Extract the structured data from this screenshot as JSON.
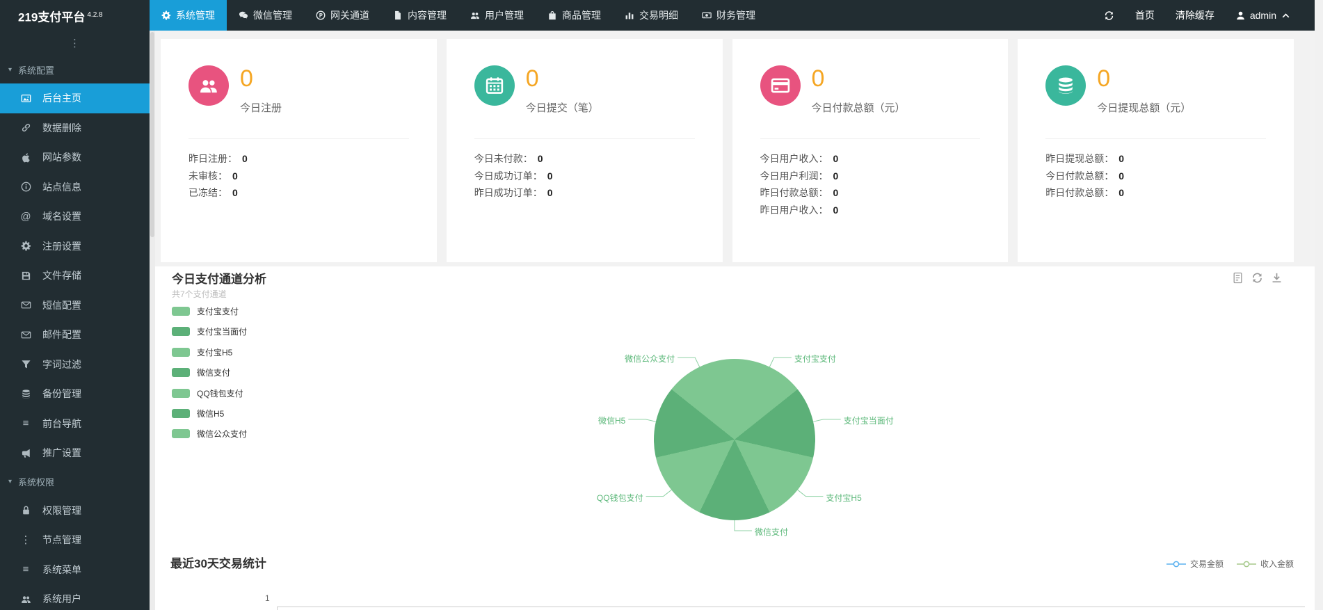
{
  "brand": {
    "title": "219支付平台",
    "version": "4.2.8"
  },
  "topnav": {
    "items": [
      {
        "label": "系统管理",
        "icon": "gear",
        "active": true
      },
      {
        "label": "微信管理",
        "icon": "wechat",
        "active": false
      },
      {
        "label": "网关通道",
        "icon": "p-circle",
        "active": false
      },
      {
        "label": "内容管理",
        "icon": "file",
        "active": false
      },
      {
        "label": "用户管理",
        "icon": "users",
        "active": false
      },
      {
        "label": "商品管理",
        "icon": "bag",
        "active": false
      },
      {
        "label": "交易明细",
        "icon": "bar-chart",
        "active": false
      },
      {
        "label": "财务管理",
        "icon": "money",
        "active": false
      }
    ],
    "right": {
      "home": "首页",
      "clear_cache": "清除缓存",
      "user": "admin"
    }
  },
  "sidebar": {
    "groups": [
      {
        "label": "系统配置",
        "items": [
          {
            "label": "后台主页",
            "icon": "image",
            "active": true
          },
          {
            "label": "数据删除",
            "icon": "link",
            "active": false
          },
          {
            "label": "网站参数",
            "icon": "apple",
            "active": false
          },
          {
            "label": "站点信息",
            "icon": "info",
            "active": false
          },
          {
            "label": "域名设置",
            "icon": "at",
            "active": false
          },
          {
            "label": "注册设置",
            "icon": "gear",
            "active": false
          },
          {
            "label": "文件存储",
            "icon": "floppy",
            "active": false
          },
          {
            "label": "短信配置",
            "icon": "envelope",
            "active": false
          },
          {
            "label": "邮件配置",
            "icon": "envelope",
            "active": false
          },
          {
            "label": "字词过滤",
            "icon": "filter",
            "active": false
          },
          {
            "label": "备份管理",
            "icon": "database",
            "active": false
          },
          {
            "label": "前台导航",
            "icon": "bars",
            "active": false
          },
          {
            "label": "推广设置",
            "icon": "bullhorn",
            "active": false
          }
        ]
      },
      {
        "label": "系统权限",
        "items": [
          {
            "label": "权限管理",
            "icon": "lock",
            "active": false
          },
          {
            "label": "节点管理",
            "icon": "ellipsis",
            "active": false
          },
          {
            "label": "系统菜单",
            "icon": "bars",
            "active": false
          },
          {
            "label": "系统用户",
            "icon": "users",
            "active": false
          }
        ]
      }
    ]
  },
  "cards": [
    {
      "icon": "users",
      "icon_bg": "#e8537f",
      "value": "0",
      "label": "今日注册",
      "rows": [
        {
          "k": "昨日注册：",
          "v": "0"
        },
        {
          "k": "未审核：",
          "v": "0"
        },
        {
          "k": "已冻结：",
          "v": "0"
        }
      ]
    },
    {
      "icon": "calendar",
      "icon_bg": "#3ab79c",
      "value": "0",
      "label": "今日提交（笔）",
      "rows": [
        {
          "k": "今日未付款：",
          "v": "0"
        },
        {
          "k": "今日成功订单：",
          "v": "0"
        },
        {
          "k": "昨日成功订单：",
          "v": "0"
        }
      ]
    },
    {
      "icon": "credit-card",
      "icon_bg": "#e8537f",
      "value": "0",
      "label": "今日付款总额（元）",
      "rows": [
        {
          "k": "今日用户收入：",
          "v": "0"
        },
        {
          "k": "今日用户利润：",
          "v": "0"
        },
        {
          "k": "昨日付款总额：",
          "v": "0"
        },
        {
          "k": "昨日用户收入：",
          "v": "0"
        }
      ]
    },
    {
      "icon": "database",
      "icon_bg": "#3ab79c",
      "value": "0",
      "label": "今日提现总额（元）",
      "rows": [
        {
          "k": "昨日提现总额：",
          "v": "0"
        },
        {
          "k": "今日付款总额：",
          "v": "0"
        },
        {
          "k": "昨日付款总额：",
          "v": "0"
        }
      ]
    }
  ],
  "pie_section": {
    "title": "今日支付通道分析",
    "subtitle": "共7个支付通道",
    "toolbox": [
      "data-view",
      "restore",
      "download"
    ]
  },
  "line_section": {
    "title": "最近30天交易统计",
    "legend": [
      {
        "label": "交易金额",
        "color": "#5ab1ef"
      },
      {
        "label": "收入金额",
        "color": "#a5c98a"
      }
    ],
    "axis_first_tick": "1"
  },
  "chart_data": [
    {
      "type": "pie",
      "title": "今日支付通道分析",
      "subtitle": "共7个支付通道",
      "labels": [
        "支付宝支付",
        "支付宝当面付",
        "支付宝H5",
        "微信支付",
        "QQ钱包支付",
        "微信H5",
        "微信公众支付"
      ],
      "values": [
        0,
        0,
        0,
        0,
        0,
        0,
        0
      ],
      "note": "all values are 0 so the 7 slices render equally",
      "colors": [
        "#7ec791",
        "#5cb078"
      ],
      "label_color": "#5cb87a",
      "legend_position": "left"
    },
    {
      "type": "line",
      "title": "最近30天交易统计",
      "series": [
        {
          "name": "交易金额",
          "color": "#5ab1ef",
          "values": []
        },
        {
          "name": "收入金额",
          "color": "#a5c98a",
          "values": []
        }
      ],
      "y_first_tick": "1",
      "legend_position": "top-right",
      "note": "only the chart top edge (first y tick and axis line) is visible in the screenshot"
    }
  ],
  "colors": {
    "accent_blue": "#199ed8",
    "value_orange": "#f5a623",
    "badge_pink": "#e8537f",
    "badge_teal": "#3ab79c"
  }
}
